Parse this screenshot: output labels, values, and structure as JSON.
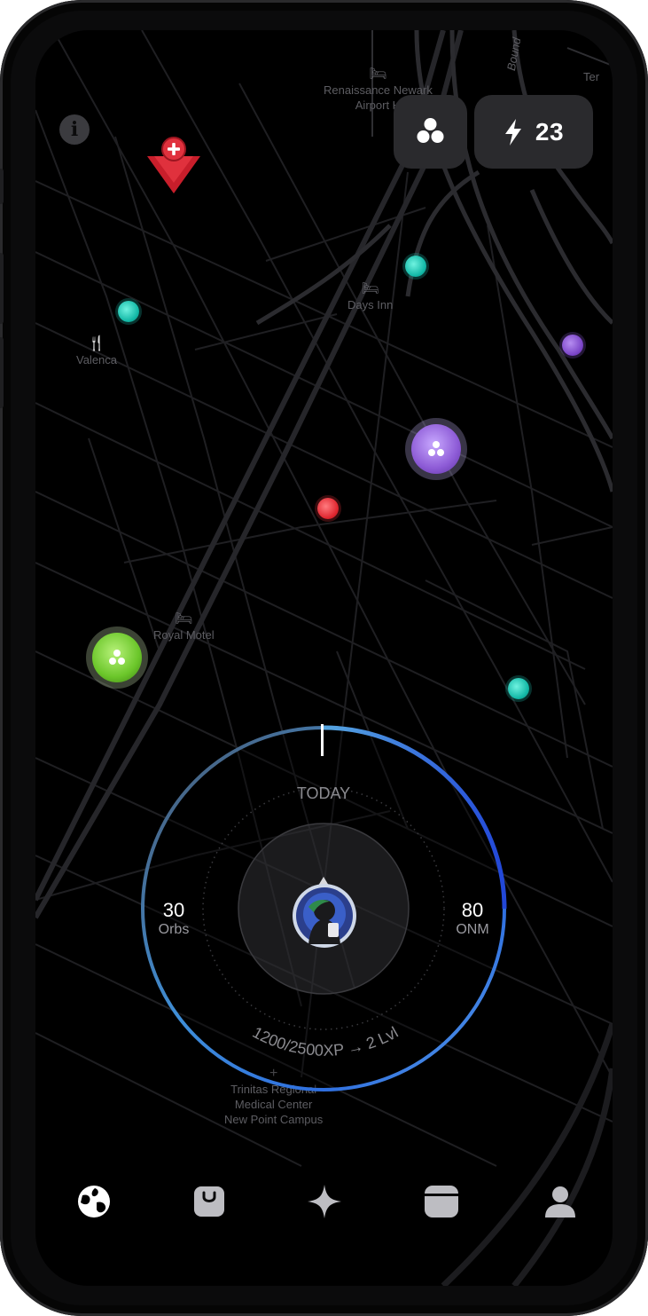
{
  "map": {
    "labels": {
      "renaissance": "Renaissance Newark\nAirport H",
      "days_inn": "Days Inn",
      "valenca": "Valenca",
      "royal_motel": "Royal Motel",
      "trinitas": "Trinitas Regional\nMedical Center\nNew Point Campus",
      "bound": "Bound",
      "ter": "Ter"
    }
  },
  "header": {
    "energy_value": "23",
    "icons": {
      "info": "info-icon",
      "orbs": "orbs-icon",
      "energy": "lightning-icon"
    }
  },
  "dial": {
    "today_label": "TODAY",
    "left_value": "30",
    "left_label": "Orbs",
    "right_value": "80",
    "right_label": "ONM",
    "xp_text": "1200/2500XP → 2 Lvl"
  },
  "tabbar": {
    "items": [
      {
        "icon": "globe-icon",
        "active": true
      },
      {
        "icon": "bag-icon",
        "active": false
      },
      {
        "icon": "sparkle-icon",
        "active": false
      },
      {
        "icon": "wallet-icon",
        "active": false
      },
      {
        "icon": "profile-icon",
        "active": false
      }
    ]
  },
  "colors": {
    "background": "#000000",
    "chip": "#2a2a2d",
    "teal_orb": "#1ec9b8",
    "purple_orb": "#8d5bd6",
    "red_orb": "#e8323c",
    "green_orb": "#6bc62a",
    "ring_blue": "#2f6fe0",
    "pin_red": "#c81e2b"
  }
}
